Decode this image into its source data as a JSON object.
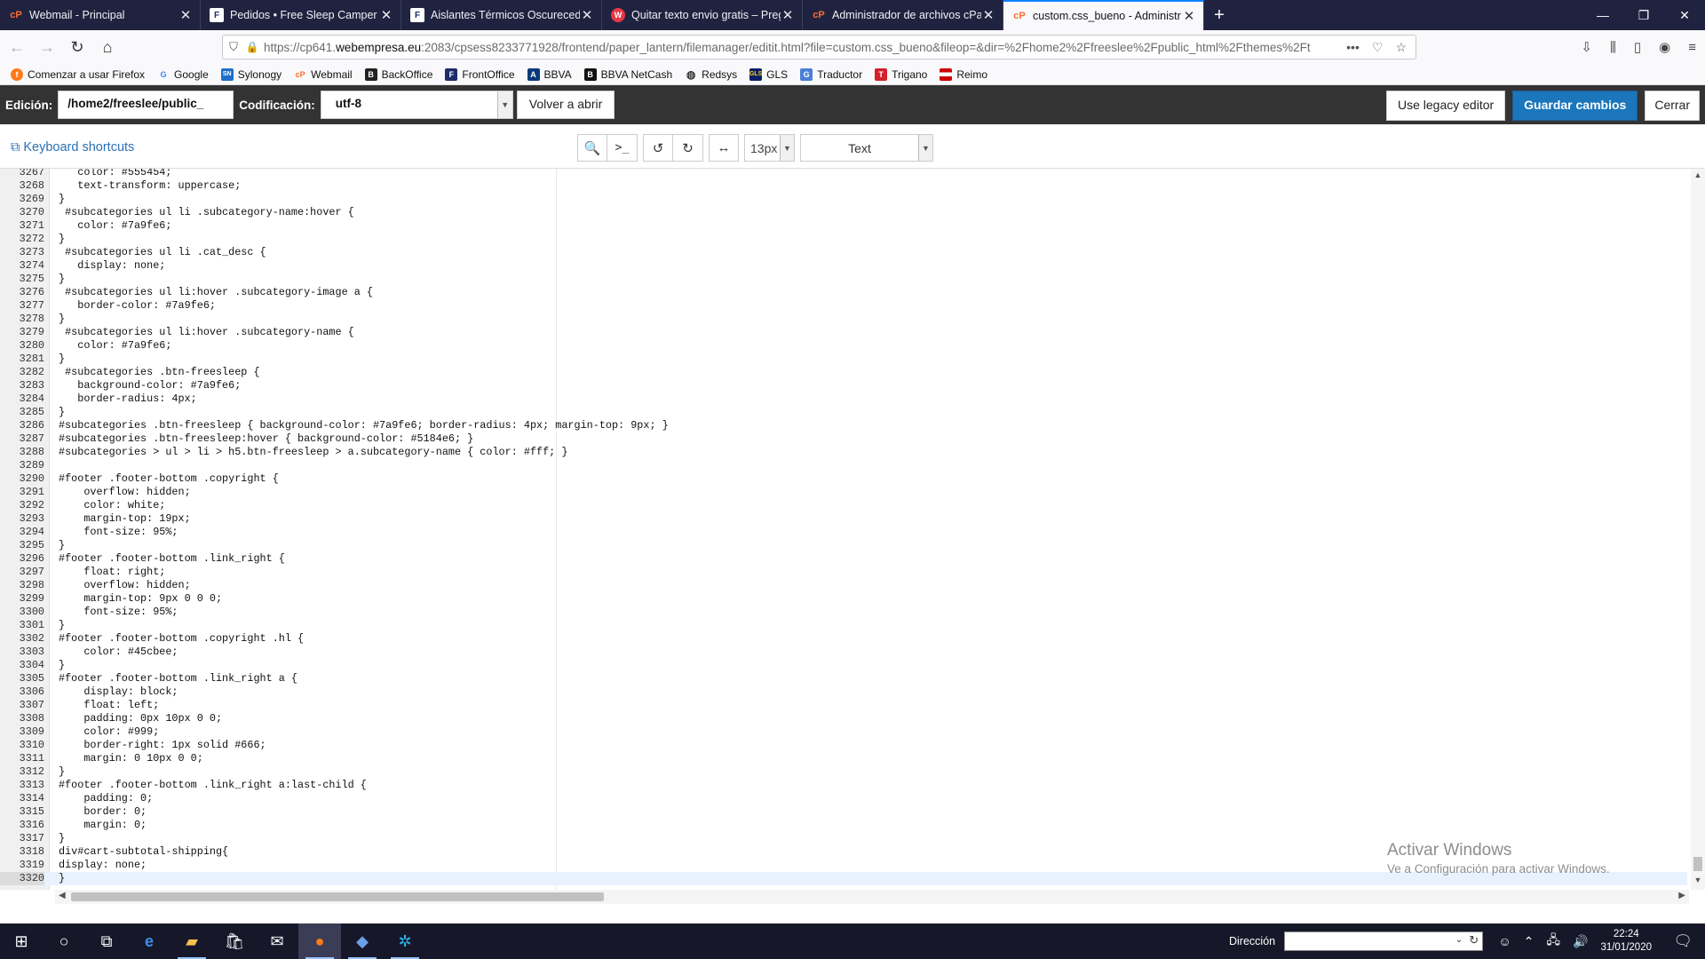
{
  "browser": {
    "tabs": [
      {
        "favicon": "cpanel-icon",
        "title": "Webmail - Principal",
        "active": false
      },
      {
        "favicon": "freesleep-icon",
        "title": "Pedidos • Free Sleep Camper C",
        "active": false
      },
      {
        "favicon": "freesleep-icon",
        "title": "Aislantes Térmicos Oscurecedo",
        "active": false
      },
      {
        "favicon": "wordpress-icon",
        "title": "Quitar texto envio gratis – Preg",
        "active": false
      },
      {
        "favicon": "cpanel-icon",
        "title": "Administrador de archivos cPa",
        "active": false
      },
      {
        "favicon": "cpanel-icon",
        "title": "custom.css_bueno - Administr",
        "active": true
      }
    ],
    "url_prefix": "https://cp641.",
    "url_domain": "webempresa.eu",
    "url_rest": ":2083/cpsess8233771928/frontend/paper_lantern/filemanager/editit.html?file=custom.css_bueno&fileop=&dir=%2Fhome2%2Ffreeslee%2Fpublic_html%2Fthemes%2Ft",
    "url_menu": "•••",
    "bookmarks": [
      {
        "icon": "firefox-icon",
        "label": "Comenzar a usar Firefox"
      },
      {
        "icon": "google-icon",
        "label": "Google"
      },
      {
        "icon": "sylonogy-icon",
        "label": "Sylonogy"
      },
      {
        "icon": "cpanel-icon",
        "label": "Webmail"
      },
      {
        "icon": "backoffice-icon",
        "label": "BackOffice"
      },
      {
        "icon": "frontoffice-icon",
        "label": "FrontOffice"
      },
      {
        "icon": "bbva-icon",
        "label": "BBVA"
      },
      {
        "icon": "bbva-netcash-icon",
        "label": "BBVA NetCash"
      },
      {
        "icon": "globe-icon",
        "label": "Redsys"
      },
      {
        "icon": "gls-icon",
        "label": "GLS"
      },
      {
        "icon": "translate-icon",
        "label": "Traductor"
      },
      {
        "icon": "trigano-icon",
        "label": "Trigano"
      },
      {
        "icon": "flag-icon",
        "label": "Reimo"
      }
    ]
  },
  "editor": {
    "edit_label": "Edición:",
    "path_value": "/home2/freeslee/public_",
    "encoding_label": "Codificación:",
    "encoding_value": "utf-8",
    "reopen_label": "Volver a abrir",
    "legacy_label": "Use legacy editor",
    "save_label": "Guardar cambios",
    "close_label": "Cerrar",
    "shortcuts_label": "Keyboard shortcuts",
    "font_size": "13px",
    "mode": "Text"
  },
  "code": {
    "first_line": 3267,
    "active_line": 3320,
    "lines": [
      "   color: #555454;",
      "   text-transform: uppercase;",
      "}",
      " #subcategories ul li .subcategory-name:hover {",
      "   color: #7a9fe6;",
      "}",
      " #subcategories ul li .cat_desc {",
      "   display: none;",
      "}",
      " #subcategories ul li:hover .subcategory-image a {",
      "   border-color: #7a9fe6;",
      "}",
      " #subcategories ul li:hover .subcategory-name {",
      "   color: #7a9fe6;",
      "}",
      " #subcategories .btn-freesleep {",
      "   background-color: #7a9fe6;",
      "   border-radius: 4px;",
      "}",
      "#subcategories .btn-freesleep { background-color: #7a9fe6; border-radius: 4px; margin-top: 9px; }",
      "#subcategories .btn-freesleep:hover { background-color: #5184e6; }",
      "#subcategories > ul > li > h5.btn-freesleep > a.subcategory-name { color: #fff; }",
      "",
      "#footer .footer-bottom .copyright {",
      "    overflow: hidden;",
      "    color: white;",
      "    margin-top: 19px;",
      "    font-size: 95%;",
      "}",
      "#footer .footer-bottom .link_right {",
      "    float: right;",
      "    overflow: hidden;",
      "    margin-top: 9px 0 0 0;",
      "    font-size: 95%;",
      "}",
      "#footer .footer-bottom .copyright .hl {",
      "    color: #45cbee;",
      "}",
      "#footer .footer-bottom .link_right a {",
      "    display: block;",
      "    float: left;",
      "    padding: 0px 10px 0 0;",
      "    color: #999;",
      "    border-right: 1px solid #666;",
      "    margin: 0 10px 0 0;",
      "}",
      "#footer .footer-bottom .link_right a:last-child {",
      "    padding: 0;",
      "    border: 0;",
      "    margin: 0;",
      "}",
      "div#cart-subtotal-shipping{",
      "display: none;",
      "}"
    ]
  },
  "os": {
    "watermark_title": "Activar Windows",
    "watermark_sub": "Ve a Configuración para activar Windows.",
    "address_label": "Dirección",
    "time": "22:24",
    "date": "31/01/2020"
  },
  "colors": {
    "tab_strip": "#202340",
    "save_button": "#1b76bc",
    "link": "#2a72b5"
  }
}
